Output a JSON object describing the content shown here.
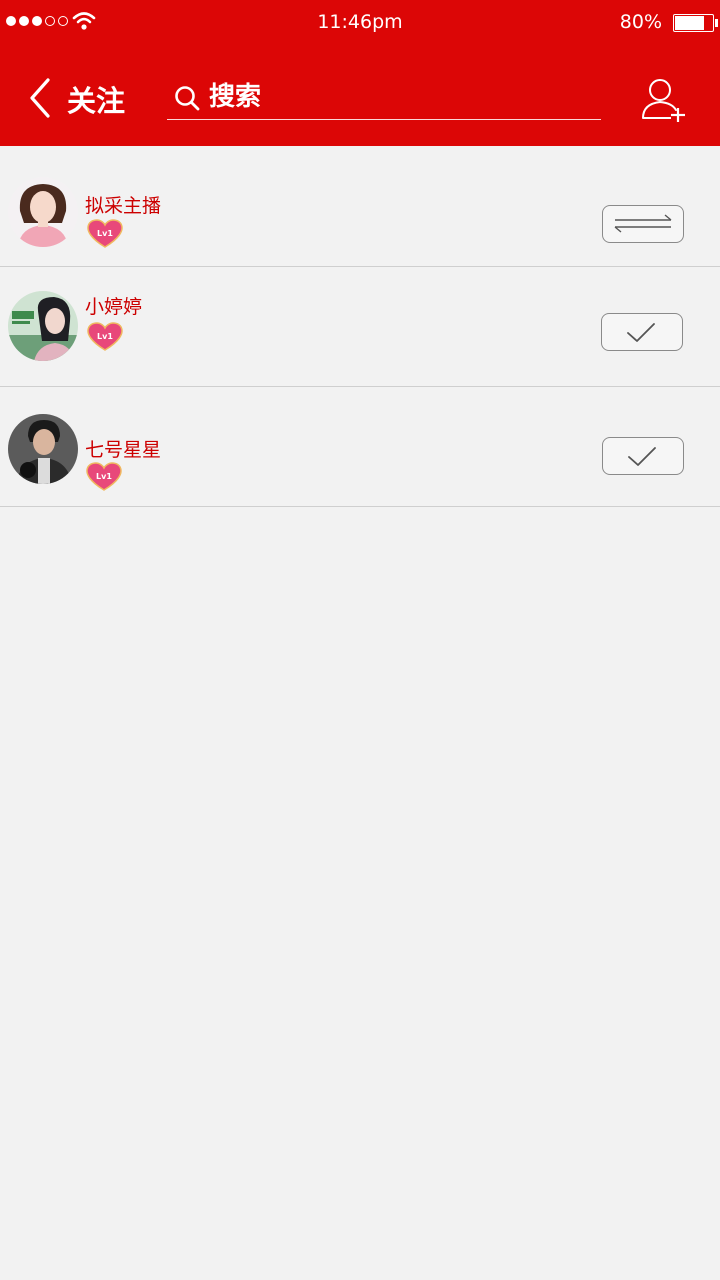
{
  "status_bar": {
    "time": "11:46pm",
    "battery_percent": "80%",
    "battery_level": 0.8,
    "signal_bars_filled": 3,
    "signal_bars_total": 5
  },
  "nav": {
    "back_icon": "chevron-left-icon",
    "title": "关注",
    "search_placeholder": "搜索",
    "search_value": "",
    "add_user_icon": "add-user-icon"
  },
  "colors": {
    "brand_red": "#dc0606",
    "name_red": "#cc0000",
    "background": "#f2f2f2"
  },
  "follows": [
    {
      "name": "拟采主播",
      "level": "Lv1",
      "status": "mutual",
      "status_icon": "mutual-follow-icon"
    },
    {
      "name": "小婷婷",
      "level": "Lv1",
      "status": "following",
      "status_icon": "check-icon"
    },
    {
      "name": "七号星星",
      "level": "Lv1",
      "status": "following",
      "status_icon": "check-icon"
    }
  ]
}
